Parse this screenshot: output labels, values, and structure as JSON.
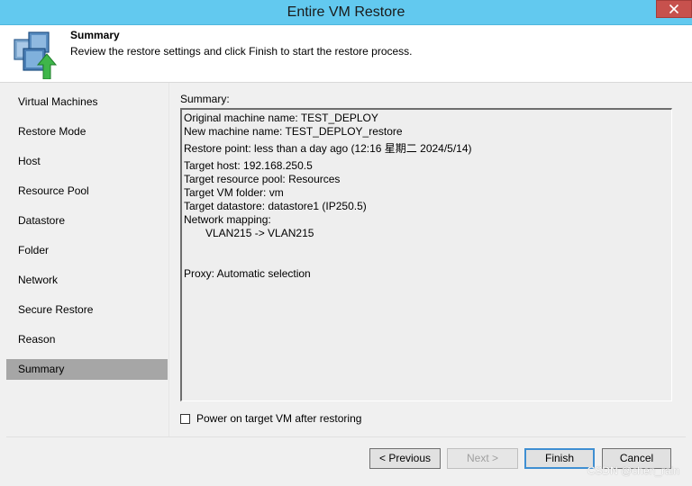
{
  "window": {
    "title": "Entire VM Restore",
    "close_symbol": "✕"
  },
  "header": {
    "title": "Summary",
    "description": "Review the restore settings and click Finish to start the restore process.",
    "icon": "vm-restore-icon"
  },
  "nav": {
    "items": [
      {
        "label": "Virtual Machines",
        "active": false
      },
      {
        "label": "Restore Mode",
        "active": false
      },
      {
        "label": "Host",
        "active": false
      },
      {
        "label": "Resource Pool",
        "active": false
      },
      {
        "label": "Datastore",
        "active": false
      },
      {
        "label": "Folder",
        "active": false
      },
      {
        "label": "Network",
        "active": false
      },
      {
        "label": "Secure Restore",
        "active": false
      },
      {
        "label": "Reason",
        "active": false
      },
      {
        "label": "Summary",
        "active": true
      }
    ]
  },
  "summary": {
    "label": "Summary:",
    "lines": {
      "original_name": "Original machine name: TEST_DEPLOY",
      "new_name": "New machine name: TEST_DEPLOY_restore",
      "restore_point": "Restore point: less than a day ago (12:16 星期二 2024/5/14)",
      "target_host": "Target host: 192.168.250.5",
      "resource_pool": "Target resource pool: Resources",
      "vm_folder": "Target VM folder: vm",
      "datastore": "Target datastore: datastore1 (IP250.5)",
      "network_mapping": "Network mapping:",
      "network_entry": "VLAN215 -> VLAN215",
      "proxy": "Proxy: Automatic selection"
    }
  },
  "power_on": {
    "label": "Power on target VM after restoring",
    "checked": false
  },
  "buttons": {
    "previous": "< Previous",
    "next": "Next >",
    "finish": "Finish",
    "cancel": "Cancel"
  },
  "watermark": "CSDN @chen_rain",
  "colors": {
    "titlebar": "#62c9ef",
    "close": "#c7514d",
    "nav_active": "#a6a6a6"
  }
}
